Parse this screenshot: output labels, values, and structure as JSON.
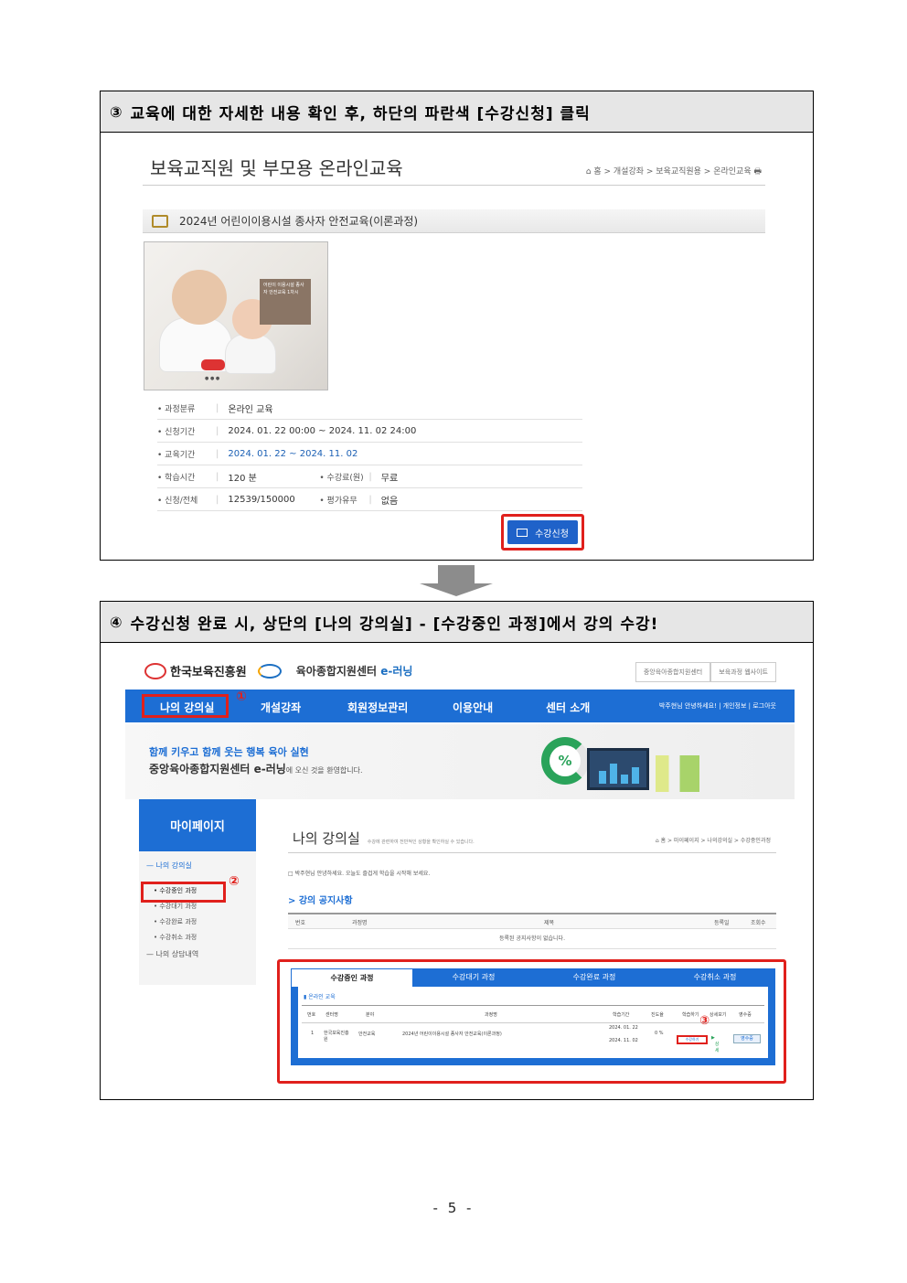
{
  "step3": {
    "num": "③",
    "title": "교육에 대한 자세한 내용 확인 후, 하단의 파란색 [수강신청] 클릭",
    "page_title": "보육교직원 및 부모용 온라인교육",
    "breadcrumb": "홈 > 개설강좌 > 보육교직원용 > 온라인교육",
    "course_name": "2024년 어린이이용시설 종사자 안전교육(이론과정)",
    "thumb_text": "어린이 이용시설 종사자 안전교육 1차시",
    "info": {
      "category_label": "과정분류",
      "category_value": "온라인 교육",
      "apply_period_label": "신청기간",
      "apply_period_value": "2024. 01. 22 00:00 ~ 2024. 11. 02 24:00",
      "edu_period_label": "교육기간",
      "edu_period_value": "2024. 01. 22 ~ 2024. 11. 02",
      "study_time_label": "학습시간",
      "study_time_value": "120 분",
      "fee_label": "수강료(원)",
      "fee_value": "무료",
      "apply_total_label": "신청/전체",
      "apply_total_value": "12539/150000",
      "eval_label": "평가유무",
      "eval_value": "없음"
    },
    "apply_button": "수강신청"
  },
  "step4": {
    "num": "④",
    "title": "수강신청 완료 시, 상단의 [나의 강의실] - [수강중인 과정]에서 강의 수강!",
    "logo1": "한국보육진흥원",
    "logo2_a": "육아종합지원센터",
    "logo2_b": "e-러닝",
    "top_links": [
      "중앙육아종합지원센터",
      "보육과정 웹사이트"
    ],
    "gnb": [
      "나의 강의실",
      "개설강좌",
      "회원정보관리",
      "이용안내",
      "센터 소개"
    ],
    "gnb_user": "박주현님 안녕하세요! | 개인정보 | 로그아웃",
    "banner_line1": "함께 키우고 함께 웃는 행복 육아 실현",
    "banner_line2": "중앙육아종합지원센터 e-러닝",
    "banner_line2_tail": "에 오신 것을 환영합니다.",
    "mypage": "마이페이지",
    "side_group1": "— 나의 강의실",
    "side_items": [
      "• 수강중인 과정",
      "• 수강대기 과정",
      "• 수강완료 과정",
      "• 수강취소 과정"
    ],
    "side_group2": "— 나의 상담내역",
    "content_title": "나의 강의실",
    "content_sub": "수강에 관련하여 전반적인 상황을 확인하실 수 있습니다.",
    "content_crumb": "홈 > 마이페이지 > 나의강의실 > 수강중인과정",
    "greeting": "박주현님 안녕하세요. 오늘도 즐겁게 학습을 시작해 보세요.",
    "notice_title": "> 강의 공지사항",
    "notice_cols": [
      "번호",
      "과정명",
      "제목",
      "등록일",
      "조회수"
    ],
    "notice_empty": "등록된 공지사항이 없습니다.",
    "tabs": [
      "수강중인 과정",
      "수강대기 과정",
      "수강완료 과정",
      "수강취소 과정"
    ],
    "category": "온라인 교육",
    "table_cols": [
      "번호",
      "센터명",
      "분야",
      "과정명",
      "학습기간",
      "진도율",
      "학습하기",
      "상세보기",
      "영수증"
    ],
    "row": {
      "no": "1",
      "center": "한국보육진흥원",
      "field": "안전교육",
      "course": "2024년 어린이이용시설 종사자 안전교육(이론과정)",
      "period_start": "2024. 01. 22",
      "period_end": "2024. 11. 02",
      "progress": "0 %",
      "study_btn": "수강하기",
      "detail_btn": "상세",
      "receipt_btn": "영수증"
    },
    "markers": [
      "①",
      "②",
      "③"
    ]
  },
  "page_number": "- 5 -",
  "colors": {
    "accent_blue": "#1d6ed4",
    "highlight_red": "#e0201c",
    "header_gray": "#e6e6e6"
  }
}
